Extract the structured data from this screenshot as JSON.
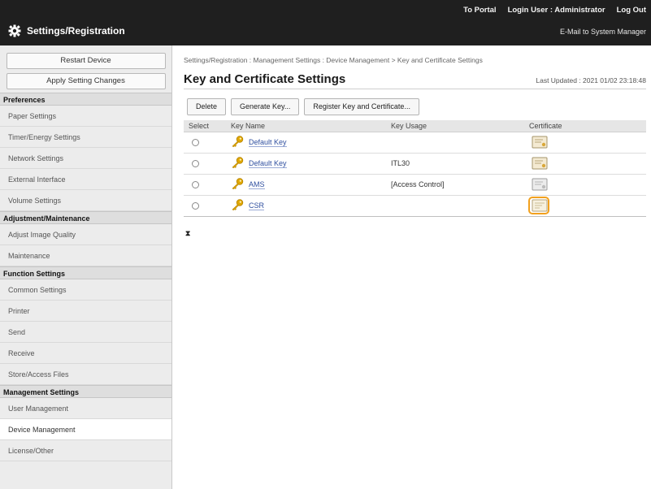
{
  "header": {
    "app_title": "Settings/Registration",
    "portal_label": "To Portal",
    "login_user_label": "Login User :",
    "login_user_name": "Administrator",
    "logout_label": "Log Out",
    "mail_link": "E-Mail to System Manager"
  },
  "sidebar": {
    "restart_label": "Restart Device",
    "apply_label": "Apply Setting Changes",
    "sections": [
      {
        "title": "Preferences",
        "items": [
          "Paper Settings",
          "Timer/Energy Settings",
          "Network Settings",
          "External Interface",
          "Volume Settings"
        ]
      },
      {
        "title": "Adjustment/Maintenance",
        "items": [
          "Adjust Image Quality",
          "Maintenance"
        ]
      },
      {
        "title": "Function Settings",
        "items": [
          "Common Settings",
          "Printer",
          "Send",
          "Receive",
          "Store/Access Files"
        ]
      },
      {
        "title": "Management Settings",
        "items": [
          "User Management",
          "Device Management",
          "License/Other"
        ]
      }
    ],
    "active_item": "Device Management"
  },
  "main": {
    "breadcrumb": "Settings/Registration : Management Settings : Device Management > Key and Certificate Settings",
    "title": "Key and Certificate Settings",
    "last_updated": "Last Updated : 2021 01/02 23:18:48",
    "toolbar": {
      "delete_label": "Delete",
      "generate_label": "Generate Key...",
      "register_label": "Register Key and Certificate..."
    },
    "table": {
      "headers": [
        "Select",
        "Key Name",
        "Key Usage",
        "Certificate"
      ],
      "rows": [
        {
          "key_name": "Default Key",
          "key_usage": "",
          "certificate": "certificate-icon",
          "highlighted": false
        },
        {
          "key_name": "Default Key",
          "key_usage": "ITL30",
          "certificate": "certificate-icon",
          "highlighted": false
        },
        {
          "key_name": "AMS",
          "key_usage": "[Access Control]",
          "certificate": "certificate-icon",
          "highlighted": false
        },
        {
          "key_name": "CSR",
          "key_usage": "",
          "certificate": "certificate-request-icon",
          "highlighted": true
        }
      ]
    },
    "top_anchor": "⧗"
  },
  "colors": {
    "header_bg": "#1f1f1f",
    "sidebar_bg": "#ececec",
    "link": "#2f4f9f",
    "highlight": "#f2a11e",
    "key_icon": "#e0a800"
  }
}
